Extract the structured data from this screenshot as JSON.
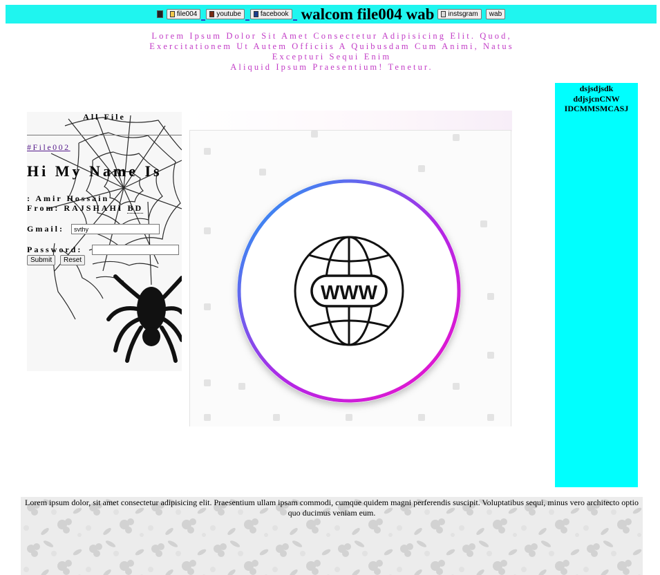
{
  "topbar": {
    "nav_buttons": [
      "file004",
      "youtube",
      "facebook"
    ],
    "title": "walcom file004 wab",
    "right_buttons": [
      "instsgram",
      "wab"
    ]
  },
  "tagline": {
    "line1": "Lorem Ipsum Dolor Sit Amet Consectetur Adipisicing Elit. Quod,",
    "line2": "Exercitationem Ut Autem Officiis A Quibusdam Cum Animi, Natus",
    "line3": "Excepturi Sequi Enim",
    "line4": "Aliquid Ipsum Praesentium! Tenetur."
  },
  "left_panel": {
    "header": "All File",
    "link": "#File002",
    "heading": "Hi My Name Is",
    "name_line": ": Amir Hossain",
    "from_prefix": "From: RAJSHAHI",
    "from_abbr": "BD",
    "gmail_label": "Gmail:",
    "gmail_value": "svthy",
    "password_label": "Password:",
    "password_value": "",
    "submit_label": "Submit",
    "reset_label": "Reset"
  },
  "center_image": {
    "badge_text": "WWW",
    "icon": "globe-www-icon",
    "ring_colors": [
      "#1aa3f5",
      "#b028e6",
      "#f012c9"
    ]
  },
  "right_bar": {
    "lines": [
      "dsjsdjsdk",
      "ddjsjcnCNW",
      "IDCMMSMCASJ"
    ]
  },
  "footer": {
    "text": "Lorem ipsum dolor, sit amet consectetur adipisicing elit. Praesentium ullam ipsam commodi, cumque quidem magni perferendis suscipit. Voluptatibus sequi, minus vero architecto optio quo ducimus veniam eum."
  },
  "colors": {
    "topbar_bg": "#1ff5ef",
    "tagline": "#c23bc6",
    "right_bar_bg": "#00fffe",
    "link": "#551a8b"
  }
}
